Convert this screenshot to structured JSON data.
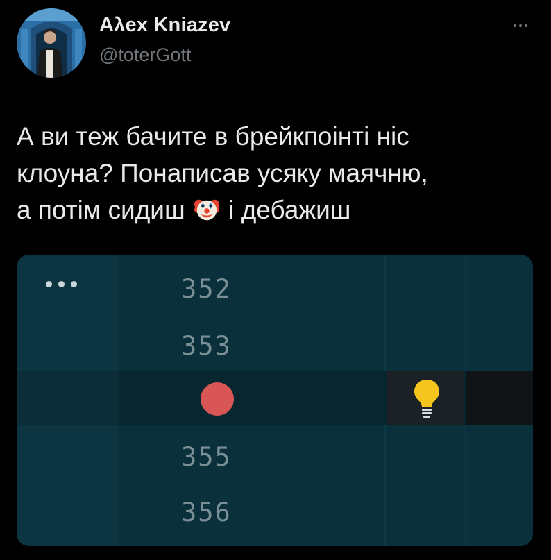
{
  "author": {
    "display_name": "Aλex Kniazev",
    "handle": "@toterGott",
    "avatar_icon": "profile-photo"
  },
  "more_icon": "more-horizontal-icon",
  "tweet": {
    "line1": "А ви теж бачите в брейкпоінті ніс",
    "line2": "клоуна? Понаписав усяку маячню,",
    "line3_before": "а потім сидиш",
    "line3_after": "і дебажиш",
    "emoji": "clown-face-emoji"
  },
  "ide": {
    "line_numbers": [
      "352",
      "353",
      "355",
      "356"
    ],
    "breakpoint_line": "354",
    "colors": {
      "background": "#0a303c",
      "breakpoint": "#d95656",
      "bulb": "#f5c51e",
      "line_number": "#7b8f96"
    },
    "icons": {
      "menu": "more-dots-icon",
      "breakpoint": "breakpoint-dot-icon",
      "hint": "lightbulb-icon"
    }
  }
}
